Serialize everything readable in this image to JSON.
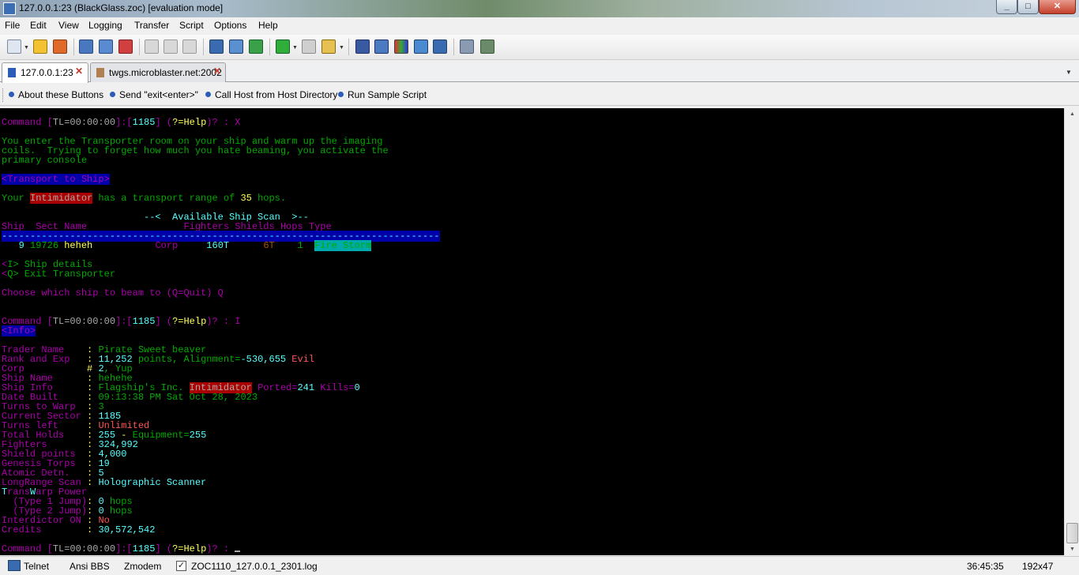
{
  "window": {
    "title": "127.0.0.1:23 (BlackGlass.zoc) [evaluation mode]"
  },
  "menu": [
    "File",
    "Edit",
    "View",
    "Logging",
    "Transfer",
    "Script",
    "Options",
    "Help"
  ],
  "tabs": [
    {
      "label": "127.0.0.1:23",
      "active": true
    },
    {
      "label": "twgs.microblaster.net:2002",
      "active": false
    }
  ],
  "user_buttons": [
    "About these Buttons",
    "Send \"exit<enter>\"",
    "Call Host from Host Directory",
    "Run Sample Script"
  ],
  "colors": {
    "magenta": "#aa00aa",
    "green": "#00aa00",
    "cyan": "#55ffff",
    "yellow": "#ffff55",
    "gray": "#aaaaaa",
    "red": "#ff5555",
    "white": "#ffffff",
    "darkcyan": "#00aaaa",
    "brown": "#aa5500",
    "blue_bg": "#0000aa",
    "red_bg": "#aa0000",
    "cyan_bg": "#00aaaa"
  },
  "terminal": {
    "lines": [
      [
        [
          "Command [",
          "magenta"
        ],
        [
          "TL=00:00:00",
          "gray"
        ],
        [
          "]:[",
          "magenta"
        ],
        [
          "1185",
          "cyan"
        ],
        [
          "] (",
          "magenta"
        ],
        [
          "?=Help",
          "yellow"
        ],
        [
          ")? : ",
          "magenta"
        ],
        [
          "X",
          "magenta"
        ]
      ],
      [],
      [
        [
          "You enter the Transporter room on your ship and warm up the imaging",
          "green"
        ]
      ],
      [
        [
          "coils.  Trying to forget how much you hate beaming, you activate the",
          "green"
        ]
      ],
      [
        [
          "primary console",
          "green"
        ]
      ],
      [],
      [
        [
          "<Transport to Ship>",
          "magenta",
          "blue_bg"
        ]
      ],
      [],
      [
        [
          "Your ",
          "green"
        ],
        [
          "Intimidator",
          "gray",
          "red_bg"
        ],
        [
          " has a transport range of ",
          "green"
        ],
        [
          "35",
          "yellow"
        ],
        [
          " hops.",
          "green"
        ]
      ],
      [],
      [
        [
          "                         --<  Available Ship Scan  >--",
          "cyan"
        ]
      ],
      [
        [
          "Ship  Sect Name                 Fighters Shields Hops Type",
          "magenta"
        ]
      ],
      [
        [
          "-----------------------------------------------------------------------------",
          "cyan",
          "blue_bg"
        ]
      ],
      [
        [
          "   9 ",
          "cyan"
        ],
        [
          "19726 ",
          "green"
        ],
        [
          "heheh",
          "yellow"
        ],
        [
          "           ",
          "gray"
        ],
        [
          "Corp",
          "magenta"
        ],
        [
          "     ",
          "gray"
        ],
        [
          "160T",
          "cyan"
        ],
        [
          "      ",
          "gray"
        ],
        [
          "6T",
          "brown"
        ],
        [
          "    ",
          "gray"
        ],
        [
          "1",
          "green"
        ],
        [
          "  ",
          "gray"
        ],
        [
          "Fire Storm",
          "green",
          "cyan_bg"
        ]
      ],
      [],
      [
        [
          "<",
          "magenta"
        ],
        [
          "I",
          "green"
        ],
        [
          "> Ship details",
          "green"
        ]
      ],
      [
        [
          "<",
          "magenta"
        ],
        [
          "Q",
          "green"
        ],
        [
          "> Exit Transporter",
          "green"
        ]
      ],
      [],
      [
        [
          "Choose which ship to beam to (Q=Quit) ",
          "magenta"
        ],
        [
          "Q",
          "magenta"
        ]
      ],
      [],
      [],
      [
        [
          "Command [",
          "magenta"
        ],
        [
          "TL=00:00:00",
          "gray"
        ],
        [
          "]:[",
          "magenta"
        ],
        [
          "1185",
          "cyan"
        ],
        [
          "] (",
          "magenta"
        ],
        [
          "?=Help",
          "yellow"
        ],
        [
          ")? : ",
          "magenta"
        ],
        [
          "I",
          "magenta"
        ]
      ],
      [
        [
          "<Info>",
          "magenta",
          "blue_bg"
        ]
      ],
      [],
      [
        [
          "Trader Name    ",
          "magenta"
        ],
        [
          ": ",
          "yellow"
        ],
        [
          "Pirate Sweet beaver",
          "green"
        ]
      ],
      [
        [
          "Rank and Exp   ",
          "magenta"
        ],
        [
          ": ",
          "yellow"
        ],
        [
          "11,252",
          "cyan"
        ],
        [
          " points, Alignment=",
          "green"
        ],
        [
          "-530,655",
          "cyan"
        ],
        [
          " Evil",
          "red"
        ]
      ],
      [
        [
          "Corp           ",
          "magenta"
        ],
        [
          "# ",
          "yellow"
        ],
        [
          "2",
          "cyan"
        ],
        [
          ", Yup",
          "green"
        ]
      ],
      [
        [
          "Ship Name      ",
          "magenta"
        ],
        [
          ": ",
          "yellow"
        ],
        [
          "hehehe",
          "green"
        ]
      ],
      [
        [
          "Ship Info      ",
          "magenta"
        ],
        [
          ": ",
          "yellow"
        ],
        [
          "Flagship's Inc. ",
          "green"
        ],
        [
          "Intimidator",
          "gray",
          "red_bg"
        ],
        [
          " Ported=",
          "magenta"
        ],
        [
          "241",
          "cyan"
        ],
        [
          " Kills=",
          "magenta"
        ],
        [
          "0",
          "cyan"
        ]
      ],
      [
        [
          "Date Built     ",
          "magenta"
        ],
        [
          ": ",
          "yellow"
        ],
        [
          "09:13:38 PM Sat Oct 28, 2023",
          "green"
        ]
      ],
      [
        [
          "Turns to Warp  ",
          "magenta"
        ],
        [
          ": ",
          "yellow"
        ],
        [
          "3",
          "green"
        ]
      ],
      [
        [
          "Current Sector ",
          "magenta"
        ],
        [
          ": ",
          "yellow"
        ],
        [
          "1185",
          "cyan"
        ]
      ],
      [
        [
          "Turns left     ",
          "magenta"
        ],
        [
          ": ",
          "yellow"
        ],
        [
          "Unlimited",
          "red"
        ]
      ],
      [
        [
          "Total Holds    ",
          "magenta"
        ],
        [
          ": ",
          "yellow"
        ],
        [
          "255",
          "cyan"
        ],
        [
          " - ",
          "yellow"
        ],
        [
          "Equipment=",
          "green"
        ],
        [
          "255",
          "cyan"
        ]
      ],
      [
        [
          "Fighters       ",
          "magenta"
        ],
        [
          ": ",
          "yellow"
        ],
        [
          "324,992",
          "cyan"
        ]
      ],
      [
        [
          "Shield points  ",
          "magenta"
        ],
        [
          ": ",
          "yellow"
        ],
        [
          "4,000",
          "cyan"
        ]
      ],
      [
        [
          "Genesis Torps  ",
          "magenta"
        ],
        [
          ": ",
          "yellow"
        ],
        [
          "19",
          "cyan"
        ]
      ],
      [
        [
          "Atomic Detn.   ",
          "magenta"
        ],
        [
          ": ",
          "yellow"
        ],
        [
          "5",
          "cyan"
        ]
      ],
      [
        [
          "LongRange Scan ",
          "magenta"
        ],
        [
          ": ",
          "yellow"
        ],
        [
          "Holographic Scanner",
          "cyan"
        ]
      ],
      [
        [
          "T",
          "cyan"
        ],
        [
          "rans",
          "magenta"
        ],
        [
          "W",
          "cyan"
        ],
        [
          "arp Power",
          "magenta"
        ]
      ],
      [
        [
          "  (Type 1 Jump)",
          "magenta"
        ],
        [
          ": ",
          "yellow"
        ],
        [
          "0",
          "cyan"
        ],
        [
          " hops",
          "green"
        ]
      ],
      [
        [
          "  (Type 2 Jump)",
          "magenta"
        ],
        [
          ": ",
          "yellow"
        ],
        [
          "0",
          "cyan"
        ],
        [
          " hops",
          "green"
        ]
      ],
      [
        [
          "Interdictor ON ",
          "magenta"
        ],
        [
          ": ",
          "yellow"
        ],
        [
          "No",
          "red"
        ]
      ],
      [
        [
          "Credits        ",
          "magenta"
        ],
        [
          ": ",
          "yellow"
        ],
        [
          "30,572,542",
          "cyan"
        ]
      ],
      [],
      [
        [
          "Command [",
          "magenta"
        ],
        [
          "TL=00:00:00",
          "gray"
        ],
        [
          "]:[",
          "magenta"
        ],
        [
          "1185",
          "cyan"
        ],
        [
          "] (",
          "magenta"
        ],
        [
          "?=Help",
          "yellow"
        ],
        [
          ")? : ",
          "magenta"
        ]
      ]
    ]
  },
  "status": {
    "protocol": "Telnet",
    "emulation": "Ansi BBS",
    "transfer": "Zmodem",
    "logfile": "ZOC1110_127.0.0.1_2301.log",
    "log_enabled": true,
    "timer": "36:45:35",
    "dimensions": "192x47"
  }
}
